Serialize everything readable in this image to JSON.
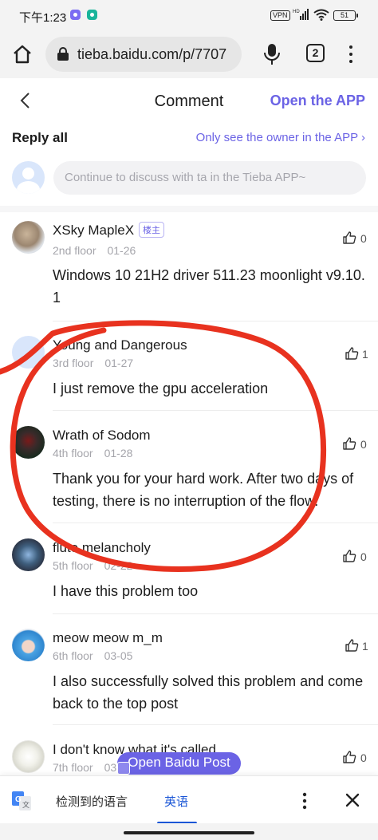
{
  "status_bar": {
    "time": "下午1:23",
    "vpn": "VPN",
    "battery": "51"
  },
  "browser": {
    "url": "tieba.baidu.com/p/7707",
    "tab_count": "2"
  },
  "header": {
    "title": "Comment",
    "open_app": "Open the APP"
  },
  "reply_section": {
    "label": "Reply all",
    "owner_link": "Only see the owner in the APP ›",
    "composer_placeholder": "Continue to discuss with ta in the Tieba APP~"
  },
  "comments": [
    {
      "author": "XSky MapleX",
      "badge": "楼主",
      "floor": "2nd floor",
      "date": "01-26",
      "text": "Windows 10 21H2 driver 511.23 moonlight v9.10.1",
      "likes": "0"
    },
    {
      "author": "Young and Dangerous",
      "floor": "3rd floor",
      "date": "01-27",
      "text": "I just remove the gpu acceleration",
      "likes": "1"
    },
    {
      "author": "Wrath of Sodom",
      "floor": "4th floor",
      "date": "01-28",
      "text": "Thank you for your hard work. After two days of testing, there is no interruption of the flow.",
      "likes": "0"
    },
    {
      "author": "flute melancholy",
      "floor": "5th floor",
      "date": "02-22",
      "text": "I have this problem too",
      "likes": "0"
    },
    {
      "author": "meow meow m_m",
      "floor": "6th floor",
      "date": "03-05",
      "text": "I also successfully solved this problem and come back to the top post",
      "likes": "1"
    },
    {
      "author": "I don't know what it's called",
      "floor": "7th floor",
      "date": "03",
      "text": "",
      "likes": "0"
    }
  ],
  "floating_button": {
    "label": "Open Baidu Post"
  },
  "translate_bar": {
    "detected": "检测到的语言",
    "target": "英语"
  },
  "colors": {
    "accent": "#6b63e5",
    "annotation": "#e8321f",
    "translate_blue": "#1a56d6"
  }
}
